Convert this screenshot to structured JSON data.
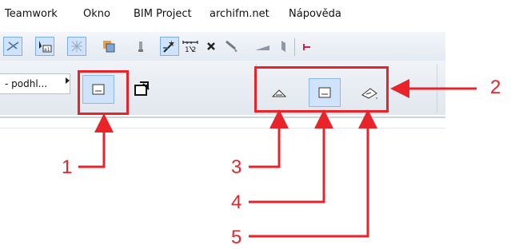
{
  "menubar": {
    "items": [
      "Teamwork",
      "Okno",
      "BIM Project",
      "archifm.net",
      "Nápověda"
    ]
  },
  "toolbar": {
    "combo_value": "- podhl...",
    "icons": [
      "trim-icon",
      "text-tag-icon",
      "hatch-icon",
      "layer-fill-icon",
      "pin-icon",
      "magic-wand-icon",
      "dimension-icon",
      "close-x-icon",
      "brush-icon",
      "ramp-icon",
      "wall-icon",
      "split-icon"
    ]
  },
  "callouts": {
    "labels": [
      "1",
      "2",
      "3",
      "4",
      "5"
    ]
  },
  "colors": {
    "accent_red": "#e8232a",
    "selected_bg": "#cfe3fb",
    "selected_border": "#8eb8ea"
  }
}
